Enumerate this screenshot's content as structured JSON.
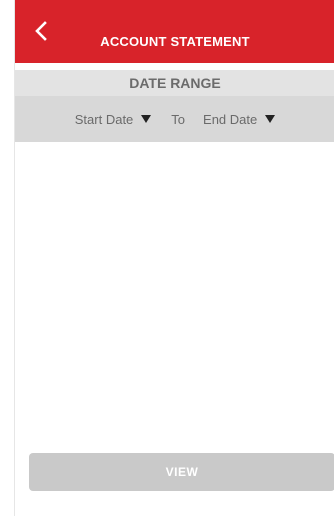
{
  "header": {
    "title": "ACCOUNT STATEMENT",
    "back_icon": "chevron-left-icon",
    "background_color": "#d8232a"
  },
  "date_range": {
    "section_label": "DATE RANGE",
    "start_date_label": "Start Date",
    "separator_label": "To",
    "end_date_label": "End Date",
    "dropdown_icon": "caret-down-icon"
  },
  "actions": {
    "view_label": "VIEW",
    "view_enabled": false
  }
}
